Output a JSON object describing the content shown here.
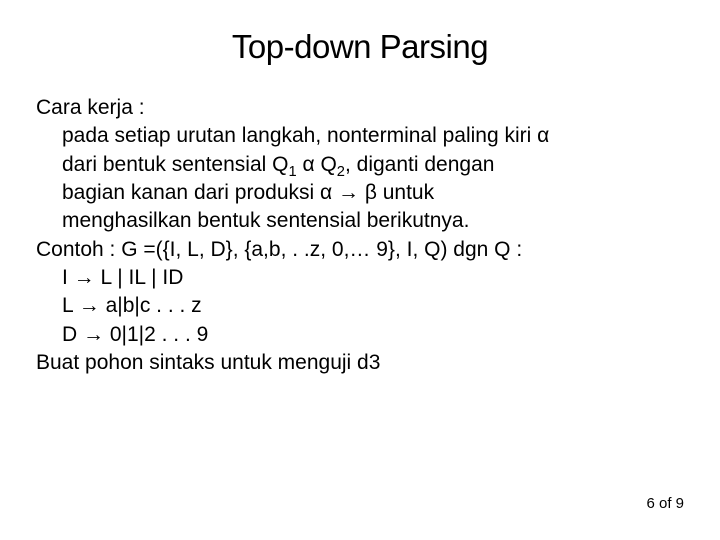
{
  "title": "Top-down Parsing",
  "lines": {
    "l0": "Cara kerja :",
    "l1": "pada setiap urutan langkah, nonterminal paling kiri α",
    "l2a": "dari bentuk sentensial Q",
    "l2_sub1": "1",
    "l2b": " α Q",
    "l2_sub2": "2",
    "l2c": ", diganti dengan",
    "l3": "bagian kanan dari produksi α → β untuk",
    "l4": "menghasilkan bentuk sentensial berikutnya.",
    "l5": "Contoh : G =({I, L, D}, {a,b, . .z, 0,… 9}, I, Q) dgn Q :",
    "l6": "I → L | IL | ID",
    "l7": "L → a|b|c . . . z",
    "l8": "D → 0|1|2 . . . 9",
    "l9": "Buat pohon sintaks untuk menguji d3"
  },
  "footer": "6 of 9"
}
